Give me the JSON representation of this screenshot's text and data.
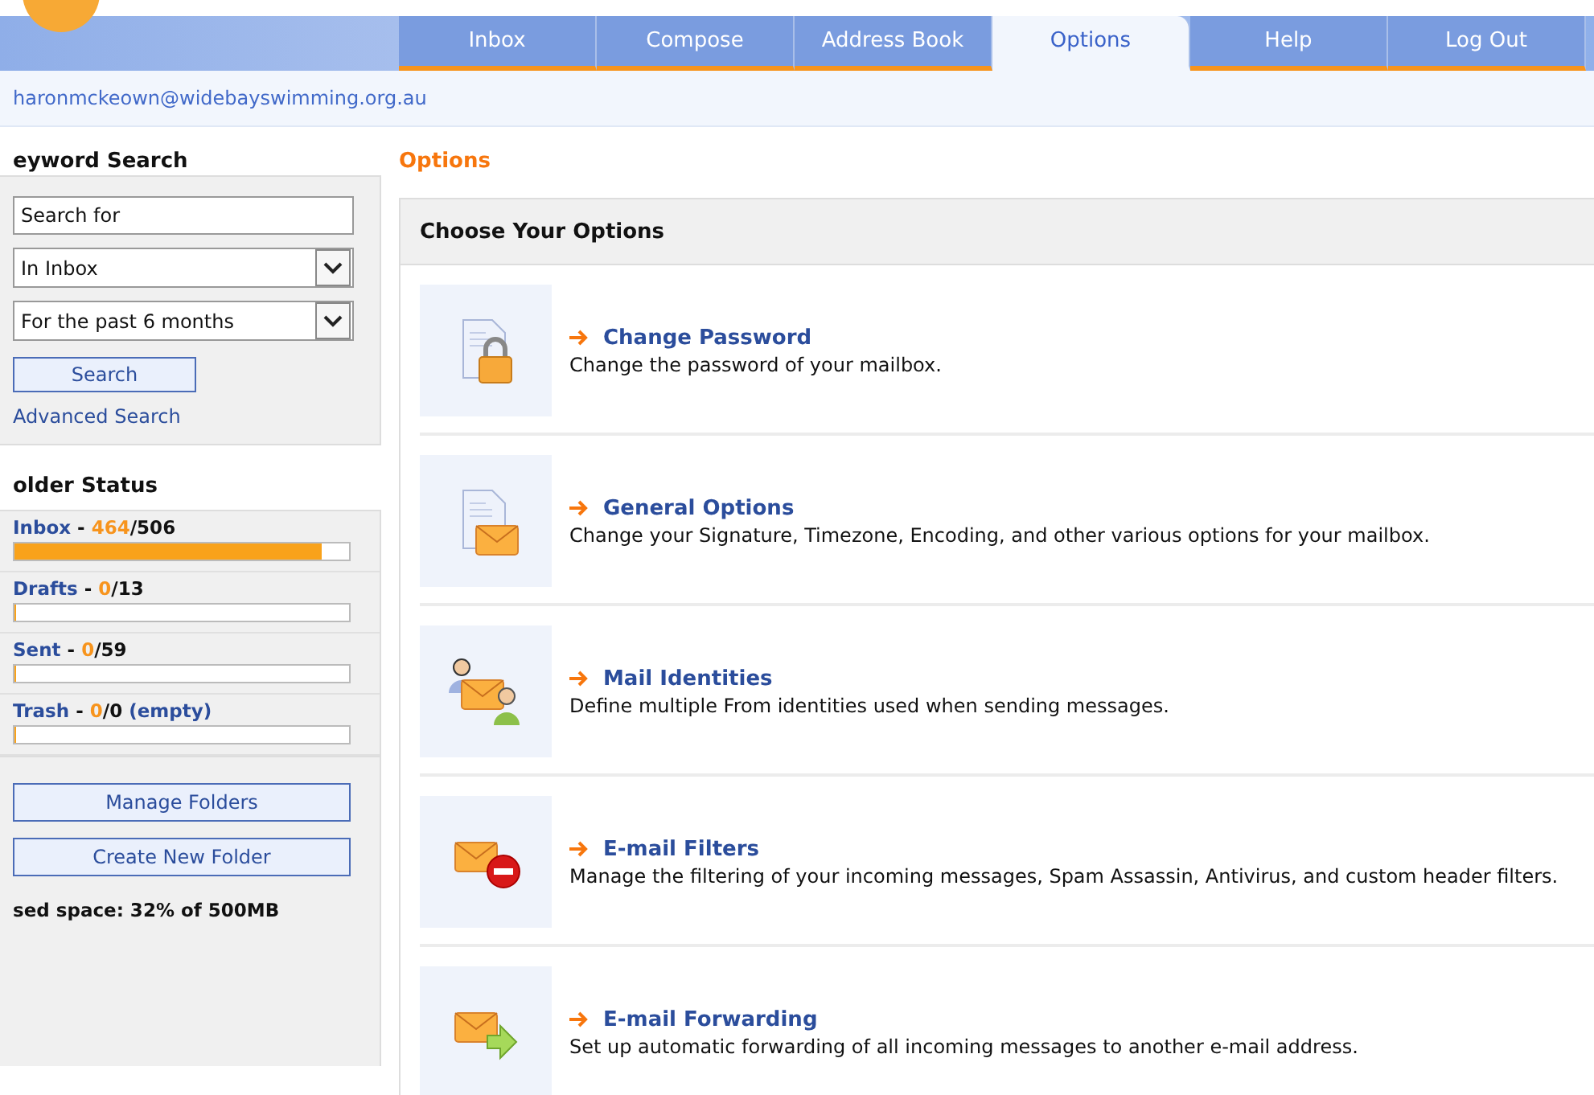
{
  "tabs": [
    {
      "label": "Inbox",
      "selected": false
    },
    {
      "label": "Compose",
      "selected": false
    },
    {
      "label": "Address Book",
      "selected": false
    },
    {
      "label": "Options",
      "selected": true
    },
    {
      "label": "Help",
      "selected": false
    },
    {
      "label": "Log Out",
      "selected": false
    }
  ],
  "account": "haronmckeown@widebayswimming.org.au",
  "sidebar": {
    "keyword_search": {
      "heading": "eyword Search",
      "placeholder": "Search for",
      "folder_select": "In Inbox",
      "period_select": "For the past 6 months",
      "search_button": "Search",
      "advanced_link": "Advanced Search"
    },
    "folder_status": {
      "heading": "older Status",
      "folders": [
        {
          "name": "Inbox",
          "separator": "-",
          "unread": "464",
          "total": "/506",
          "level": 0.92
        },
        {
          "name": "Drafts",
          "separator": "-",
          "unread": "0",
          "total": "/13",
          "level": 0
        },
        {
          "name": "Sent",
          "separator": "-",
          "unread": "0",
          "total": "/59",
          "level": 0
        },
        {
          "name": "Trash",
          "separator": "-",
          "unread": "0",
          "total": "/0",
          "extra": "(empty)",
          "level": 0
        }
      ]
    },
    "buttons": [
      "Manage Folders",
      "Create New Folder"
    ],
    "used_space": "sed space: 32% of 500MB"
  },
  "page_title": "Options",
  "panel": {
    "heading": "Choose Your Options",
    "items": [
      {
        "kind": "password",
        "title": "Change Password",
        "description": "Change the password of your mailbox."
      },
      {
        "kind": "general",
        "title": "General Options",
        "description": "Change your Signature, Timezone, Encoding, and other various options for your mailbox."
      },
      {
        "kind": "identities",
        "title": "Mail Identities",
        "description": "Define multiple From identities used when sending messages."
      },
      {
        "kind": "filters",
        "title": "E-mail Filters",
        "description": "Manage the filtering of your incoming messages, Spam Assassin, Antivirus, and custom header filters."
      },
      {
        "kind": "forwarding",
        "title": "E-mail Forwarding",
        "description": "Set up automatic forwarding of all incoming messages to another e-mail address."
      }
    ]
  }
}
